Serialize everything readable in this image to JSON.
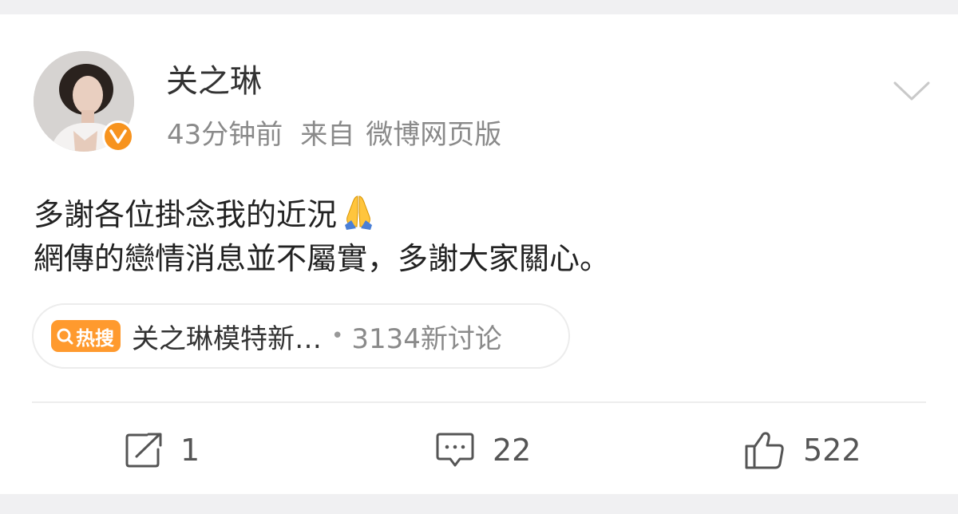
{
  "post": {
    "username": "关之琳",
    "time": "43分钟前",
    "source_prefix": "来自",
    "source": "微博网页版",
    "text_line1": "多謝各位掛念我的近況",
    "text_line2": "網傳的戀情消息並不屬實，多謝大家關心。",
    "emoji": "folded-hands"
  },
  "topic": {
    "badge_label": "热搜",
    "title": "关之琳模特新…",
    "separator": "•",
    "discussion": "3134新讨论"
  },
  "actions": {
    "repost_count": "1",
    "comment_count": "22",
    "like_count": "522"
  },
  "colors": {
    "badge_orange": "#ff9a2e",
    "verified_orange": "#f7931e",
    "meta_gray": "#8a8a8a",
    "text_dark": "#222222"
  },
  "icons": [
    "verified-v-icon",
    "chevron-down-icon",
    "search-icon",
    "repost-icon",
    "comment-icon",
    "like-icon"
  ]
}
